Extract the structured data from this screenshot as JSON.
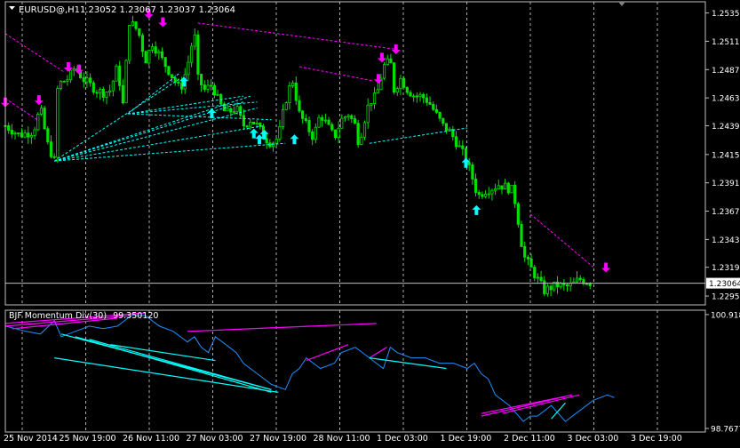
{
  "colors": {
    "background": "#000000",
    "grid": "#c0c0c0",
    "candle": "#00e000",
    "arrow_up": "#00ffff",
    "arrow_down": "#ff00ff",
    "div_line_main": "#ff00ff",
    "div_line_alt": "#00ffff",
    "indicator": "#1e90ff",
    "axis_text": "#ffffff"
  },
  "chart_data": [
    {
      "type": "candlestick",
      "title": "EURUSD@,H1  1.23052 1.23067 1.23037 1.23064",
      "symbol_title": "EURUSD@,H1",
      "ohlc_header": "1.23052 1.23067 1.23037 1.23064",
      "current_price_label": "1.23064",
      "current_price": 1.23064,
      "ylim": [
        1.2288,
        1.2545
      ],
      "y_ticks": [
        "1.25355",
        "1.25115",
        "1.24875",
        "1.24635",
        "1.24399",
        "1.24155",
        "1.23915",
        "1.23675",
        "1.23435",
        "1.23199",
        "1.22955"
      ],
      "x_ticks": [
        "25 Nov 2014",
        "25 Nov 19:00",
        "26 Nov 11:00",
        "27 Nov 03:00",
        "27 Nov 19:00",
        "28 Nov 11:00",
        "1 Dec 03:00",
        "1 Dec 19:00",
        "2 Dec 11:00",
        "3 Dec 03:00",
        "3 Dec 19:00"
      ],
      "x_range": [
        0,
        100
      ],
      "close_path": [
        [
          0,
          1.244
        ],
        [
          2,
          1.2432
        ],
        [
          4,
          1.2435
        ],
        [
          5,
          1.2455
        ],
        [
          6,
          1.2425
        ],
        [
          7,
          1.241
        ],
        [
          7.5,
          1.2475
        ],
        [
          9,
          1.248
        ],
        [
          10,
          1.249
        ],
        [
          11,
          1.248
        ],
        [
          12,
          1.2475
        ],
        [
          13,
          1.247
        ],
        [
          14,
          1.2468
        ],
        [
          15,
          1.247
        ],
        [
          16,
          1.249
        ],
        [
          17,
          1.245
        ],
        [
          17.5,
          1.253
        ],
        [
          19,
          1.252
        ],
        [
          20,
          1.2495
        ],
        [
          21,
          1.251
        ],
        [
          22,
          1.25
        ],
        [
          23,
          1.249
        ],
        [
          24,
          1.248
        ],
        [
          25,
          1.247
        ],
        [
          26,
          1.249
        ],
        [
          27,
          1.252
        ],
        [
          27.5,
          1.248
        ],
        [
          28.5,
          1.247
        ],
        [
          29.5,
          1.2475
        ],
        [
          30.5,
          1.246
        ],
        [
          31.5,
          1.245
        ],
        [
          33,
          1.2455
        ],
        [
          34,
          1.244
        ],
        [
          35,
          1.2445
        ],
        [
          36,
          1.244
        ],
        [
          37,
          1.243
        ],
        [
          38,
          1.2425
        ],
        [
          39,
          1.243
        ],
        [
          40,
          1.246
        ],
        [
          41,
          1.248
        ],
        [
          42,
          1.245
        ],
        [
          43,
          1.244
        ],
        [
          44,
          1.243
        ],
        [
          45,
          1.245
        ],
        [
          46,
          1.244
        ],
        [
          47,
          1.243
        ],
        [
          48,
          1.2445
        ],
        [
          49,
          1.245
        ],
        [
          50,
          1.244
        ],
        [
          50.5,
          1.2425
        ],
        [
          51.5,
          1.245
        ],
        [
          52,
          1.246
        ],
        [
          53,
          1.2465
        ],
        [
          54,
          1.249
        ],
        [
          55,
          1.2495
        ],
        [
          55.5,
          1.247
        ],
        [
          56.5,
          1.248
        ],
        [
          57.5,
          1.247
        ],
        [
          58.5,
          1.2465
        ],
        [
          59.5,
          1.2465
        ],
        [
          60.5,
          1.246
        ],
        [
          61.5,
          1.245
        ],
        [
          62.5,
          1.244
        ],
        [
          63.5,
          1.2435
        ],
        [
          64.5,
          1.2425
        ],
        [
          65.5,
          1.2415
        ],
        [
          66.5,
          1.24
        ],
        [
          67.5,
          1.238
        ],
        [
          68.5,
          1.2385
        ],
        [
          69.5,
          1.2387
        ],
        [
          70.5,
          1.239
        ],
        [
          71.5,
          1.2388
        ],
        [
          72.5,
          1.2385
        ],
        [
          73,
          1.237
        ],
        [
          74,
          1.233
        ],
        [
          75,
          1.232
        ],
        [
          76,
          1.231
        ],
        [
          77,
          1.23
        ],
        [
          78,
          1.2303
        ],
        [
          79,
          1.2305
        ],
        [
          80,
          1.2303
        ],
        [
          81,
          1.2305
        ],
        [
          82,
          1.231
        ],
        [
          83,
          1.2308
        ],
        [
          84,
          1.2306
        ]
      ],
      "arrows_up": [
        [
          25.5,
          1.2477
        ],
        [
          29.5,
          1.245
        ],
        [
          35.5,
          1.2433
        ],
        [
          36.3,
          1.2428
        ],
        [
          37,
          1.2432
        ],
        [
          41.3,
          1.2428
        ],
        [
          65.8,
          1.2408
        ],
        [
          67.3,
          1.2368
        ]
      ],
      "arrows_down": [
        [
          0,
          1.246
        ],
        [
          4.8,
          1.2462
        ],
        [
          9,
          1.249
        ],
        [
          10.5,
          1.2488
        ],
        [
          20.5,
          1.2535
        ],
        [
          22.5,
          1.2528
        ],
        [
          53.8,
          1.2498
        ],
        [
          55.8,
          1.2505
        ],
        [
          53.3,
          1.248
        ],
        [
          85.8,
          1.232
        ]
      ],
      "div_lines_up": [
        [
          [
            7,
            1.241
          ],
          [
            25,
            1.248
          ]
        ],
        [
          [
            7,
            1.241
          ],
          [
            35,
            1.2465
          ]
        ],
        [
          [
            7,
            1.241
          ],
          [
            37,
            1.244
          ]
        ],
        [
          [
            7,
            1.241
          ],
          [
            40,
            1.2425
          ]
        ],
        [
          [
            7,
            1.241
          ],
          [
            36,
            1.2455
          ]
        ],
        [
          [
            7,
            1.241
          ],
          [
            34,
            1.246
          ]
        ],
        [
          [
            17.5,
            1.245
          ],
          [
            34,
            1.2465
          ]
        ],
        [
          [
            17.5,
            1.245
          ],
          [
            36,
            1.246
          ]
        ],
        [
          [
            17.5,
            1.245
          ],
          [
            38,
            1.2445
          ]
        ],
        [
          [
            17.5,
            1.245
          ],
          [
            25,
            1.2485
          ]
        ],
        [
          [
            52,
            1.2425
          ],
          [
            66,
            1.2438
          ]
        ]
      ],
      "div_lines_down": [
        [
          [
            0,
            1.2518
          ],
          [
            8.5,
            1.2485
          ]
        ],
        [
          [
            0,
            1.2463
          ],
          [
            4.8,
            1.2444
          ]
        ],
        [
          [
            27.5,
            1.2527
          ],
          [
            55.5,
            1.2505
          ]
        ],
        [
          [
            42,
            1.249
          ],
          [
            52.5,
            1.2478
          ]
        ],
        [
          [
            75,
            1.2365
          ],
          [
            84,
            1.232
          ]
        ]
      ]
    },
    {
      "type": "line",
      "title": "BJF Momentum Div(30) 99.350120",
      "indicator_name": "BJF Momentum Div(30)",
      "indicator_value": "99.350120",
      "ylim": [
        98.7,
        101.0
      ],
      "y_ticks": [
        "100.918",
        "98.7677"
      ],
      "x_range": [
        0,
        100
      ],
      "x": [
        0,
        3,
        5,
        7,
        8,
        10,
        12,
        14,
        16,
        18,
        20,
        22,
        24,
        26,
        27,
        28,
        29,
        30,
        32,
        33,
        34,
        36,
        38,
        40,
        41,
        42,
        43,
        44,
        45,
        47,
        48,
        50,
        52,
        54,
        55,
        56,
        58,
        60,
        62,
        64,
        66,
        67,
        68,
        69,
        70,
        72,
        74,
        75,
        76,
        78,
        80,
        82,
        84,
        86,
        87
      ],
      "y": [
        100.7,
        100.6,
        100.55,
        100.8,
        100.5,
        100.6,
        100.7,
        100.65,
        100.7,
        100.9,
        100.9,
        100.7,
        100.6,
        100.4,
        100.5,
        100.3,
        100.2,
        100.5,
        100.3,
        100.2,
        100.0,
        99.8,
        99.6,
        99.5,
        99.8,
        99.9,
        100.1,
        100.0,
        99.9,
        100.0,
        100.2,
        100.3,
        100.1,
        99.9,
        100.3,
        100.2,
        100.1,
        100.1,
        100.0,
        100.0,
        99.9,
        100.0,
        99.8,
        99.7,
        99.4,
        99.2,
        98.9,
        99.0,
        99.0,
        99.2,
        98.9,
        99.1,
        99.3,
        99.4,
        99.35
      ],
      "div_lines_main": [
        [
          [
            0,
            100.75
          ],
          [
            20,
            100.95
          ]
        ],
        [
          [
            0,
            100.7
          ],
          [
            18,
            100.9
          ]
        ],
        [
          [
            1,
            100.65
          ],
          [
            16,
            100.85
          ]
        ],
        [
          [
            26,
            100.6
          ],
          [
            53,
            100.75
          ]
        ],
        [
          [
            43,
            100.05
          ],
          [
            49,
            100.35
          ]
        ],
        [
          [
            52,
            100.1
          ],
          [
            54.5,
            100.3
          ]
        ],
        [
          [
            68,
            99.05
          ],
          [
            81,
            99.4
          ]
        ],
        [
          [
            68,
            99.0
          ],
          [
            80,
            99.37
          ]
        ],
        [
          [
            71,
            99.05
          ],
          [
            82,
            99.4
          ]
        ]
      ],
      "div_lines_alt": [
        [
          [
            7,
            100.1
          ],
          [
            39,
            99.45
          ]
        ],
        [
          [
            8,
            100.55
          ],
          [
            38,
            99.5
          ]
        ],
        [
          [
            10,
            100.5
          ],
          [
            38,
            99.45
          ]
        ],
        [
          [
            12,
            100.45
          ],
          [
            38,
            99.5
          ]
        ],
        [
          [
            15,
            100.35
          ],
          [
            30,
            100.05
          ]
        ],
        [
          [
            52,
            100.1
          ],
          [
            63,
            99.9
          ]
        ],
        [
          [
            78,
            98.95
          ],
          [
            80,
            99.25
          ]
        ]
      ]
    }
  ]
}
